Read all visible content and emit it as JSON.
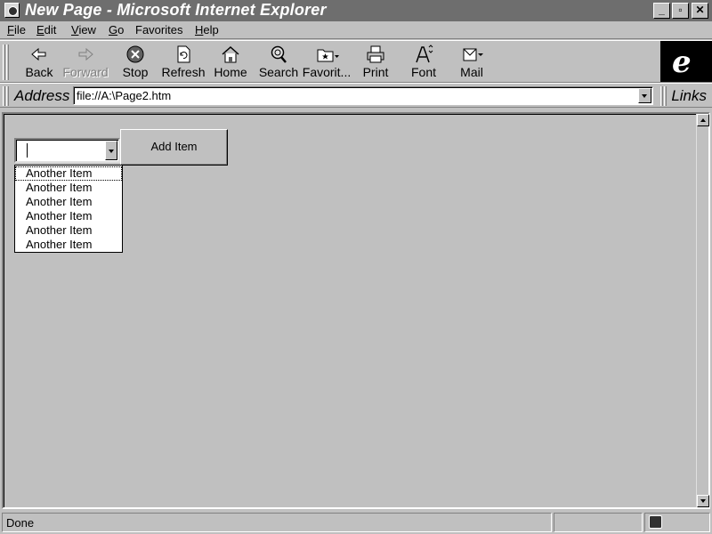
{
  "window": {
    "title": "New Page - Microsoft Internet Explorer",
    "controls": {
      "minimize": "_",
      "maximize": "▫",
      "close": "✕"
    }
  },
  "menu": {
    "items": [
      {
        "label": "File",
        "accel": "F",
        "rest": "ile"
      },
      {
        "label": "Edit",
        "accel": "E",
        "rest": "dit"
      },
      {
        "label": "View",
        "accel": "V",
        "rest": "iew"
      },
      {
        "label": "Go",
        "accel": "G",
        "rest": "o"
      },
      {
        "label": "Favorites",
        "accel": "",
        "rest": "Favorites"
      },
      {
        "label": "Help",
        "accel": "H",
        "rest": "elp"
      }
    ]
  },
  "toolbar": {
    "buttons": [
      {
        "label": "Back",
        "icon": "back-arrow-icon",
        "enabled": true
      },
      {
        "label": "Forward",
        "icon": "forward-arrow-icon",
        "enabled": false
      },
      {
        "label": "Stop",
        "icon": "stop-icon",
        "enabled": true
      },
      {
        "label": "Refresh",
        "icon": "refresh-icon",
        "enabled": true
      },
      {
        "label": "Home",
        "icon": "home-icon",
        "enabled": true
      },
      {
        "label": "Search",
        "icon": "search-icon",
        "enabled": true
      },
      {
        "label": "Favorit...",
        "icon": "favorites-folder-icon",
        "enabled": true
      },
      {
        "label": "Print",
        "icon": "printer-icon",
        "enabled": true
      },
      {
        "label": "Font",
        "icon": "font-icon",
        "enabled": true
      },
      {
        "label": "Mail",
        "icon": "mail-icon",
        "enabled": true
      }
    ],
    "logo": "e"
  },
  "address": {
    "label": "Address",
    "value": "file://A:\\Page2.htm",
    "links_label": "Links"
  },
  "page": {
    "combo_value": "",
    "add_button_label": "Add Item",
    "list_items": [
      "Another Item",
      "Another Item",
      "Another Item",
      "Another Item",
      "Another Item",
      "Another Item"
    ]
  },
  "status": {
    "text": "Done"
  }
}
